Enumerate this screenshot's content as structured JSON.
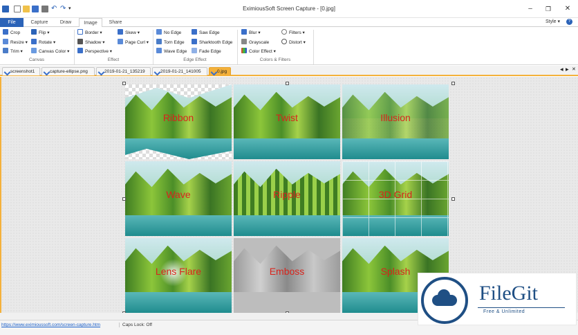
{
  "window": {
    "title": "EximiousSoft Screen Capture - [0.jpg]",
    "controls": [
      "minimize",
      "restore",
      "close"
    ]
  },
  "quick_access": [
    "app-icon",
    "new-icon",
    "open-icon",
    "save-icon",
    "print-icon",
    "undo-icon",
    "redo-icon",
    "customize-icon"
  ],
  "menu": {
    "tabs": [
      "File",
      "Capture",
      "Draw",
      "Image",
      "Share"
    ],
    "active": "Image",
    "style_label": "Style ▾",
    "help": "?"
  },
  "ribbon": {
    "groups": [
      {
        "label": "Canvas",
        "items": [
          "Crop",
          "Flip ▾",
          "Resize ▾",
          "Rotate ▾",
          "Trim ▾",
          "Canvas Color ▾"
        ]
      },
      {
        "label": "Effect",
        "items": [
          "Border ▾",
          "Skew ▾",
          "Shadow ▾",
          "Page Curl ▾",
          "Perspective ▾"
        ]
      },
      {
        "label": "Edge Effect",
        "items": [
          "No Edge",
          "Saw Edge",
          "Torn Edge",
          "Sharktooth Edge",
          "Wave Edge",
          "Fade Edge"
        ]
      },
      {
        "label": "Colors & Filters",
        "items": [
          "Blur ▾",
          "Filters ▾",
          "Grayscale",
          "Distort ▾",
          "Color Effect ▾"
        ]
      }
    ]
  },
  "documents": {
    "tabs": [
      "screenshot1",
      "capture-ellipse.png",
      "2019-01-21_135219",
      "2019-01-21_141005",
      "0.jpg"
    ],
    "active": "0.jpg"
  },
  "image": {
    "tiles": [
      "Ribbon",
      "Twist",
      "Illusion",
      "Wave",
      "Ripple",
      "3D Grid",
      "Lens Flare",
      "Emboss",
      "Splash"
    ]
  },
  "status": {
    "url": "https://www.eximioussoft.com/screen-capture.htm",
    "caps": "Caps Lock: Off"
  },
  "watermark": {
    "brand": "FileGit",
    "tagline": "Free & Unlimited"
  },
  "colors": {
    "accent": "#2b63b8",
    "active_tab": "#f4b13b",
    "label_red": "#d8241c"
  }
}
